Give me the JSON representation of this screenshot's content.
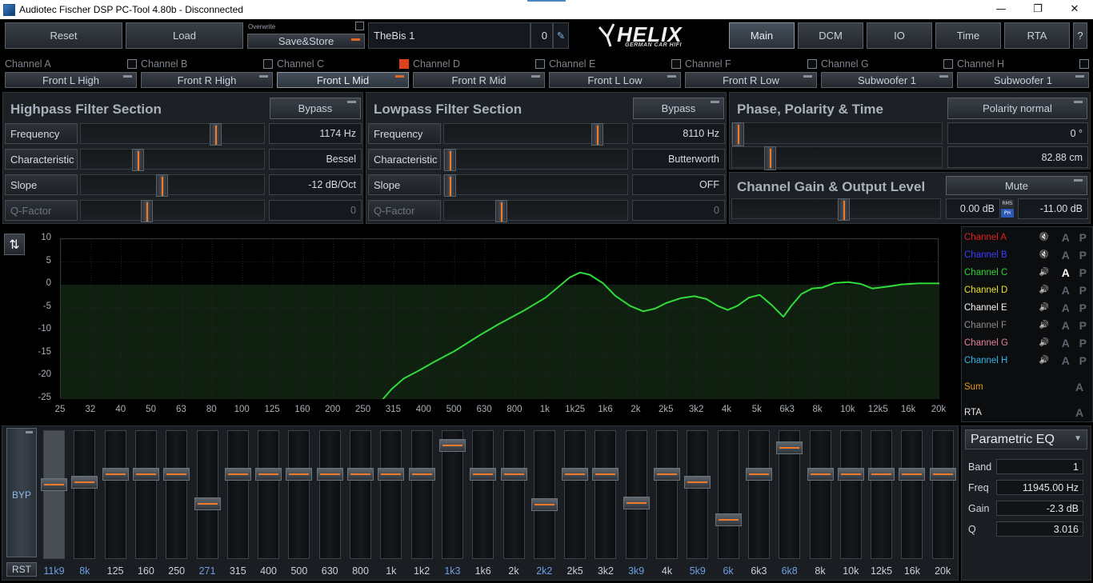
{
  "window": {
    "title": "Audiotec Fischer DSP PC-Tool 4.80b - Disconnected",
    "minimize": "—",
    "maximize": "❐",
    "close": "✕"
  },
  "toolbar": {
    "reset": "Reset",
    "load": "Load",
    "overwrite": "Overwrite",
    "save_store": "Save&Store",
    "preset_name": "TheBis 1",
    "preset_number": "0",
    "edit_icon": "✎",
    "logo_text": "HELIX",
    "logo_subtext": "GERMAN CAR HIFI"
  },
  "nav": {
    "main": "Main",
    "dcm": "DCM",
    "io": "IO",
    "time": "Time",
    "rta": "RTA",
    "help": "?"
  },
  "channels": [
    {
      "label": "Channel A",
      "name": "Front L High",
      "checked": false
    },
    {
      "label": "Channel B",
      "name": "Front R High",
      "checked": false
    },
    {
      "label": "Channel C",
      "name": "Front L Mid",
      "checked": true
    },
    {
      "label": "Channel D",
      "name": "Front R Mid",
      "checked": false
    },
    {
      "label": "Channel E",
      "name": "Front L Low",
      "checked": false
    },
    {
      "label": "Channel F",
      "name": "Front R Low",
      "checked": false
    },
    {
      "label": "Channel G",
      "name": "Subwoofer 1",
      "checked": false
    },
    {
      "label": "Channel H",
      "name": "Subwoofer 1",
      "checked": false
    }
  ],
  "highpass": {
    "title": "Highpass Filter Section",
    "bypass": "Bypass",
    "rows": [
      {
        "label": "Frequency",
        "value": "1174 Hz",
        "pos": 0.75
      },
      {
        "label": "Characteristic",
        "value": "Bessel",
        "pos": 0.3
      },
      {
        "label": "Slope",
        "value": "-12 dB/Oct",
        "pos": 0.44
      },
      {
        "label": "Q-Factor",
        "value": "0",
        "pos": 0.35
      }
    ]
  },
  "lowpass": {
    "title": "Lowpass Filter Section",
    "bypass": "Bypass",
    "rows": [
      {
        "label": "Frequency",
        "value": "8110 Hz",
        "pos": 0.86
      },
      {
        "label": "Characteristic",
        "value": "Butterworth",
        "pos": 0.0
      },
      {
        "label": "Slope",
        "value": "OFF",
        "pos": 0.0
      },
      {
        "label": "Q-Factor",
        "value": "0",
        "pos": 0.3
      }
    ]
  },
  "phase": {
    "title": "Phase, Polarity & Time",
    "polarity": "Polarity normal",
    "phase_value": "0 °",
    "phase_pos": 0.0,
    "time_value": "82.88 cm",
    "time_pos": 0.16
  },
  "gain": {
    "title": "Channel Gain & Output Level",
    "mute": "Mute",
    "gain_value": "0.00 dB",
    "rms": "RMS",
    "ph": "PH",
    "level_value": "-11.00 dB",
    "gain_pos": 0.54
  },
  "chart_data": {
    "type": "line",
    "xlabel": "",
    "ylabel": "",
    "x_scale": "log",
    "ylim": [
      -25,
      10
    ],
    "y_ticks": [
      10,
      5,
      0,
      -5,
      -10,
      -15,
      -20,
      -25
    ],
    "x_ticks": [
      "25",
      "32",
      "40",
      "50",
      "63",
      "80",
      "100",
      "125",
      "160",
      "200",
      "250",
      "315",
      "400",
      "500",
      "630",
      "800",
      "1k",
      "1k25",
      "1k6",
      "2k",
      "2k5",
      "3k2",
      "4k",
      "5k",
      "6k3",
      "8k",
      "10k",
      "12k5",
      "16k",
      "20k"
    ],
    "series": [
      {
        "color": "#2fdc3a",
        "x": [
          290,
          310,
          340,
          380,
          430,
          500,
          600,
          700,
          850,
          1000,
          1100,
          1200,
          1300,
          1400,
          1550,
          1700,
          1900,
          2100,
          2300,
          2500,
          2800,
          3100,
          3400,
          3700,
          4000,
          4300,
          4700,
          5100,
          5600,
          6100,
          6500,
          7000,
          7600,
          8200,
          9000,
          10000,
          11000,
          12000,
          13500,
          15000,
          17000,
          20000
        ],
        "values": [
          -25,
          -22.8,
          -20.5,
          -18.8,
          -16.8,
          -14.5,
          -11.2,
          -8.6,
          -5.6,
          -2.8,
          -0.5,
          1.6,
          2.7,
          2.2,
          0.3,
          -2.4,
          -4.6,
          -5.8,
          -5.2,
          -4.0,
          -2.9,
          -2.5,
          -3.1,
          -4.6,
          -5.5,
          -4.6,
          -2.8,
          -2.2,
          -4.5,
          -7.0,
          -4.5,
          -2.0,
          -0.8,
          -0.6,
          0.4,
          0.6,
          0.2,
          -0.8,
          -0.4,
          0.1,
          0.3,
          0.3
        ]
      }
    ]
  },
  "legend": {
    "items": [
      {
        "name": "Channel A",
        "color": "#e02020",
        "muted": true,
        "a_on": false
      },
      {
        "name": "Channel B",
        "color": "#3c3cff",
        "muted": true,
        "a_on": false
      },
      {
        "name": "Channel C",
        "color": "#30d530",
        "muted": false,
        "a_on": true
      },
      {
        "name": "Channel D",
        "color": "#e8e020",
        "muted": false,
        "a_on": false
      },
      {
        "name": "Channel E",
        "color": "#f2f2f2",
        "muted": false,
        "a_on": false
      },
      {
        "name": "Channel F",
        "color": "#8c8c8c",
        "muted": false,
        "a_on": false
      },
      {
        "name": "Channel G",
        "color": "#e67fa0",
        "muted": false,
        "a_on": false
      },
      {
        "name": "Channel H",
        "color": "#30b6e8",
        "muted": false,
        "a_on": false
      }
    ],
    "sum": "Sum",
    "sum_color": "#e69a1a",
    "rta": "RTA",
    "a": "A",
    "p": "P"
  },
  "eq": {
    "byp": "BYP",
    "rst": "RST",
    "bands": [
      {
        "label": "11k9",
        "pos": 0.41,
        "hi": true,
        "sel": true
      },
      {
        "label": "8k",
        "pos": 0.39,
        "hi": true
      },
      {
        "label": "125",
        "pos": 0.32
      },
      {
        "label": "160",
        "pos": 0.32
      },
      {
        "label": "250",
        "pos": 0.32
      },
      {
        "label": "271",
        "pos": 0.58,
        "hi": true
      },
      {
        "label": "315",
        "pos": 0.32
      },
      {
        "label": "400",
        "pos": 0.32
      },
      {
        "label": "500",
        "pos": 0.32
      },
      {
        "label": "630",
        "pos": 0.32
      },
      {
        "label": "800",
        "pos": 0.32
      },
      {
        "label": "1k",
        "pos": 0.32
      },
      {
        "label": "1k2",
        "pos": 0.32
      },
      {
        "label": "1k3",
        "pos": 0.07,
        "hi": true
      },
      {
        "label": "1k6",
        "pos": 0.32
      },
      {
        "label": "2k",
        "pos": 0.32
      },
      {
        "label": "2k2",
        "pos": 0.59,
        "hi": true
      },
      {
        "label": "2k5",
        "pos": 0.32
      },
      {
        "label": "3k2",
        "pos": 0.32
      },
      {
        "label": "3k9",
        "pos": 0.57,
        "hi": true
      },
      {
        "label": "4k",
        "pos": 0.32
      },
      {
        "label": "5k9",
        "pos": 0.39,
        "hi": true
      },
      {
        "label": "6k",
        "pos": 0.72,
        "hi": true
      },
      {
        "label": "6k3",
        "pos": 0.32
      },
      {
        "label": "6k8",
        "pos": 0.09,
        "hi": true
      },
      {
        "label": "8k",
        "pos": 0.32
      },
      {
        "label": "10k",
        "pos": 0.32
      },
      {
        "label": "12k5",
        "pos": 0.32
      },
      {
        "label": "16k",
        "pos": 0.32
      },
      {
        "label": "20k",
        "pos": 0.32
      }
    ]
  },
  "peq": {
    "title": "Parametric EQ",
    "band_label": "Band",
    "band": "1",
    "freq_label": "Freq",
    "freq": "11945.00 Hz",
    "gain_label": "Gain",
    "gain": "-2.3 dB",
    "q_label": "Q",
    "q": "3.016"
  }
}
